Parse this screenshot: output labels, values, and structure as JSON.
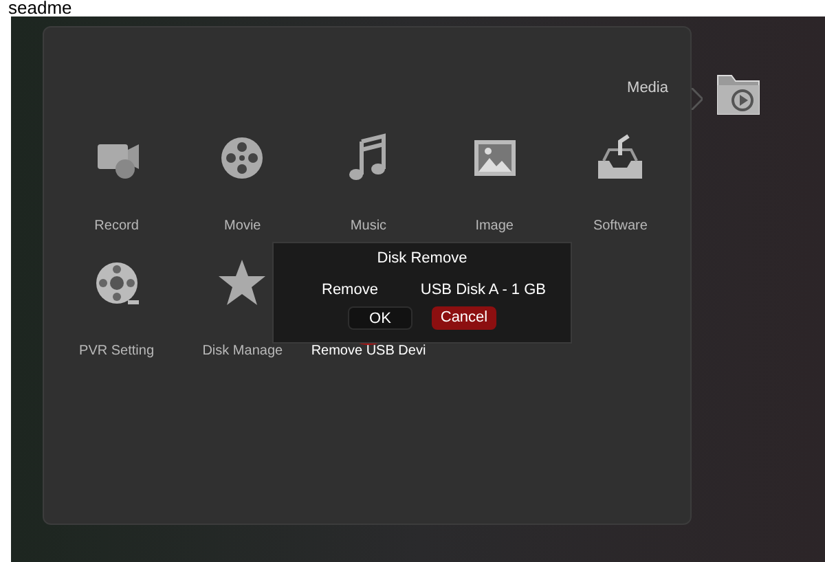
{
  "caption": "seadme",
  "menu": {
    "title": "Media",
    "items": [
      {
        "label": "Record",
        "selected": false
      },
      {
        "label": "Movie",
        "selected": false
      },
      {
        "label": "Music",
        "selected": false
      },
      {
        "label": "Image",
        "selected": false
      },
      {
        "label": "Software",
        "selected": false
      },
      {
        "label": "PVR Setting",
        "selected": false
      },
      {
        "label": "Disk Manage",
        "selected": false
      },
      {
        "label": "Remove USB Devi",
        "selected": true
      }
    ]
  },
  "dialog": {
    "title": "Disk Remove",
    "label": "Remove",
    "value": "USB Disk A - 1 GB",
    "buttons": [
      {
        "label": "OK",
        "selected": false
      },
      {
        "label": "Cancel",
        "selected": true
      }
    ]
  }
}
